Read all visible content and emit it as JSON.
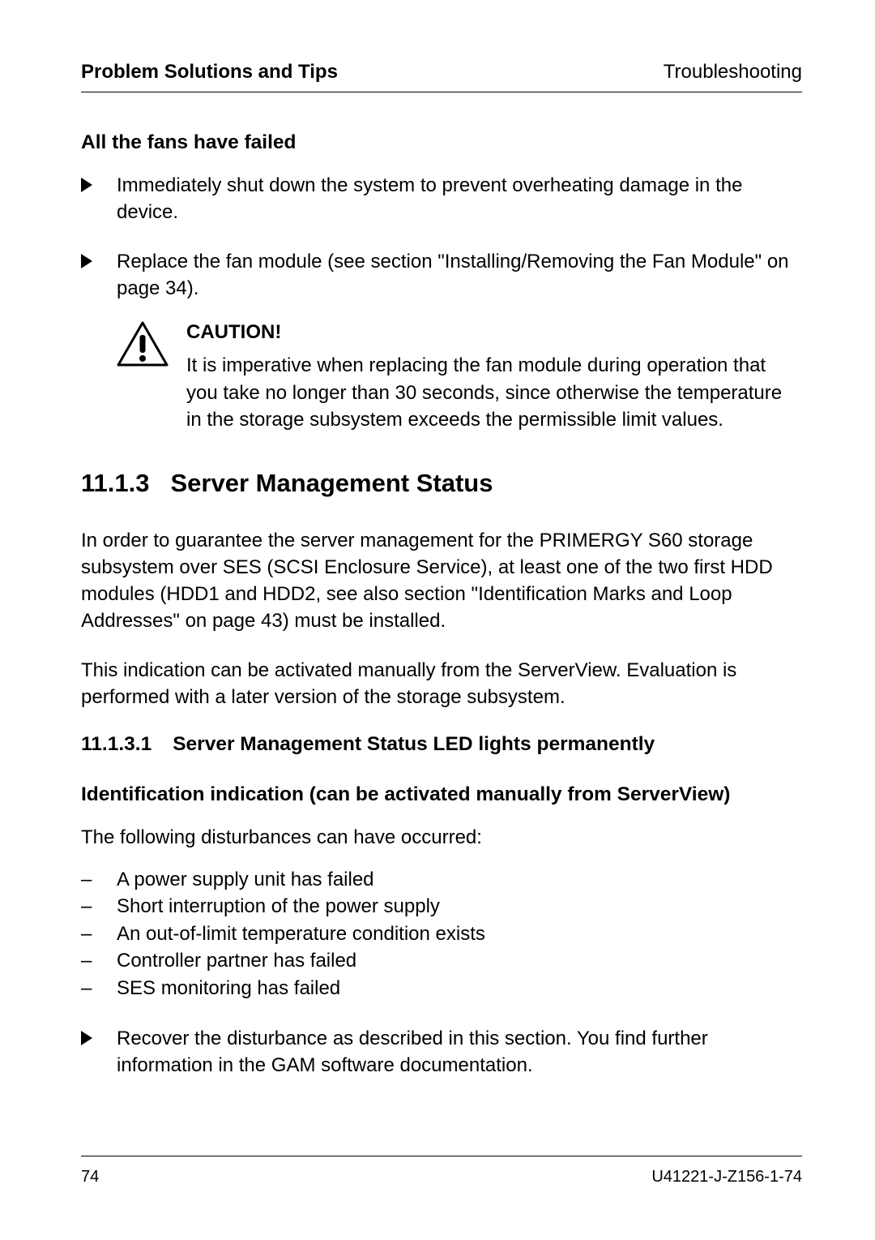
{
  "header": {
    "left": "Problem Solutions and Tips",
    "right": "Troubleshooting"
  },
  "section_fans": {
    "title": "All the fans have failed",
    "items": [
      "Immediately shut down the system to prevent overheating damage in the device.",
      "Replace the fan module (see section \"Installing/Removing the Fan Module\" on page 34)."
    ]
  },
  "caution": {
    "title": "CAUTION!",
    "body": "It is imperative when replacing the fan module during operation that you take no longer than 30 seconds, since otherwise the temperature in the storage subsystem exceeds the permissible limit values."
  },
  "h2": {
    "number": "11.1.3",
    "title": "Server Management Status"
  },
  "para1": "In order to guarantee the server management for the PRIMERGY S60 storage subsystem over SES (SCSI Enclosure Service), at least one of the two first HDD modules (HDD1 and HDD2, see also section \"Identification Marks and Loop Addresses\" on page 43) must be installed.",
  "para2": "This indication can be activated manually from the ServerView. Evaluation is performed with a later version of the storage subsystem.",
  "h3": {
    "number": "11.1.3.1",
    "title": "Server Management Status LED lights permanently"
  },
  "h4": "Identification indication (can be activated manually from ServerView)",
  "disturb_intro": "The following disturbances can have occurred:",
  "disturbances": [
    "A power supply unit has failed",
    "Short interruption of the power supply",
    "An out-of-limit temperature condition exists",
    "Controller partner has failed",
    "SES monitoring has failed"
  ],
  "recover": "Recover the disturbance as described in this section. You find further information in the GAM software documentation.",
  "footer": {
    "page": "74",
    "doc": "U41221-J-Z156-1-74"
  }
}
